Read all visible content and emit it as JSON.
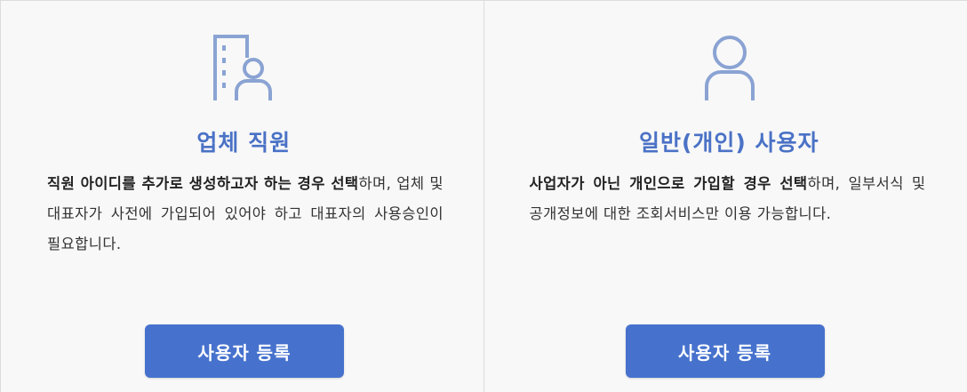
{
  "colors": {
    "accent": "#4a72c6",
    "button": "#4672cd",
    "icon": "#8aa3d3",
    "text": "#333333"
  },
  "cards": [
    {
      "icon": "building-person-icon",
      "title": "업체 직원",
      "desc_bold": "직원 아이디를 추가로 생성하고자 하는 경우 선택",
      "desc_rest": "하며, 업체 및 대표자가 사전에 가입되어 있어야 하고 대표자의 사용승인이 필요합니다.",
      "button_label": "사용자 등록"
    },
    {
      "icon": "person-icon",
      "title": "일반(개인) 사용자",
      "desc_bold": "사업자가 아닌 개인으로 가입할 경우 선택",
      "desc_rest": "하며, 일부서식 및 공개정보에 대한 조회서비스만 이용 가능합니다.",
      "button_label": "사용자 등록"
    }
  ]
}
